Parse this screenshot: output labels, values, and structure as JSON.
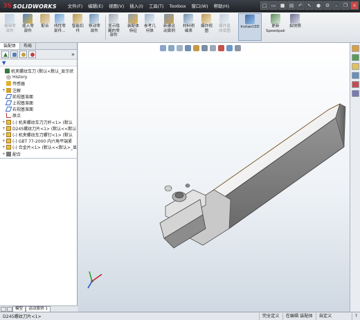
{
  "app": {
    "name": "SOLIDWORKS"
  },
  "menu": [
    "文件(F)",
    "编辑(E)",
    "视图(V)",
    "插入(I)",
    "工具(T)",
    "Toolbox",
    "窗口(W)",
    "帮助(H)"
  ],
  "toolbar": [
    {
      "label": "编辑零\n部件",
      "disabled": true,
      "color": "#7fa3c8"
    },
    {
      "label": "插入零\n部件",
      "disabled": false,
      "color": "#4c86c6"
    },
    {
      "label": "配合",
      "disabled": false,
      "color": "#c0a46a"
    },
    {
      "label": "线性零\n部件...",
      "disabled": false,
      "color": "#6a9ed0"
    },
    {
      "label": "智能扣\n件",
      "disabled": false,
      "color": "#b89850"
    },
    {
      "label": "移动零\n部件",
      "disabled": false,
      "color": "#6c8fb8"
    },
    {
      "label": "显示隐\n藏的零\n部件",
      "disabled": false,
      "color": "#a0a8b4"
    },
    {
      "label": "装配体\n特征",
      "disabled": false,
      "color": "#8a9fb6"
    },
    {
      "label": "参考几\n何体",
      "disabled": false,
      "color": "#9bb1c9"
    },
    {
      "label": "新建运\n动算例",
      "disabled": false,
      "color": "#7b96b3"
    },
    {
      "label": "材料明\n细表",
      "disabled": false,
      "color": "#6e8fb0"
    },
    {
      "label": "爆炸视\n图",
      "disabled": false,
      "color": "#c09a58"
    },
    {
      "label": "爆炸直\n线草图",
      "disabled": true,
      "color": "#8aa3bb"
    },
    {
      "label": "Instant3D",
      "disabled": false,
      "active": true,
      "color": "#3f6aa8"
    },
    {
      "label": "更新\nSpeedpak",
      "disabled": false,
      "color": "#5c8a5c"
    },
    {
      "label": "拍快照",
      "disabled": false,
      "color": "#6d6f8f"
    }
  ],
  "panel": {
    "tabs": [
      "装配体",
      "布局"
    ],
    "filter_icon": "filter-icon",
    "tree": [
      {
        "label": "机夹螺纹车刀  (默认<默认_显示状",
        "indent": 0,
        "icon": "assembly",
        "exp": ""
      },
      {
        "label": "History",
        "indent": 1,
        "icon": "history",
        "exp": ""
      },
      {
        "label": "传感器",
        "indent": 1,
        "icon": "sensor",
        "exp": ""
      },
      {
        "label": "注解",
        "indent": 1,
        "icon": "annotation",
        "exp": "+"
      },
      {
        "label": "前视基准面",
        "indent": 1,
        "icon": "plane",
        "exp": ""
      },
      {
        "label": "上视基准面",
        "indent": 1,
        "icon": "plane",
        "exp": ""
      },
      {
        "label": "右视基准面",
        "indent": 1,
        "icon": "plane",
        "exp": ""
      },
      {
        "label": "原点",
        "indent": 1,
        "icon": "origin",
        "exp": ""
      },
      {
        "label": "(-) 机夹螺纹车刀刀杆<1> (默认",
        "indent": 1,
        "icon": "part",
        "exp": "+"
      },
      {
        "label": "D245螺纹刀片<1> (默认<<默认",
        "indent": 1,
        "icon": "part",
        "exp": "+"
      },
      {
        "label": "(-) 机夹螺纹车刀螺钉<1> (默认",
        "indent": 1,
        "icon": "part",
        "exp": "+"
      },
      {
        "label": "(-) GBT 77-2000 内六角平端紧",
        "indent": 1,
        "icon": "part",
        "exp": "+"
      },
      {
        "label": "(-) 合金片<1> (默认<<默认>_显",
        "indent": 1,
        "icon": "part",
        "exp": "+"
      },
      {
        "label": "配合",
        "indent": 1,
        "icon": "mate",
        "exp": "+"
      }
    ],
    "bottom_tabs": [
      "模型",
      "运动算例 1"
    ]
  },
  "status": {
    "left": "D245螺纹刀片<1>",
    "cells": [
      "完全定义",
      "在编辑 装配体",
      "自定义",
      "?"
    ]
  }
}
